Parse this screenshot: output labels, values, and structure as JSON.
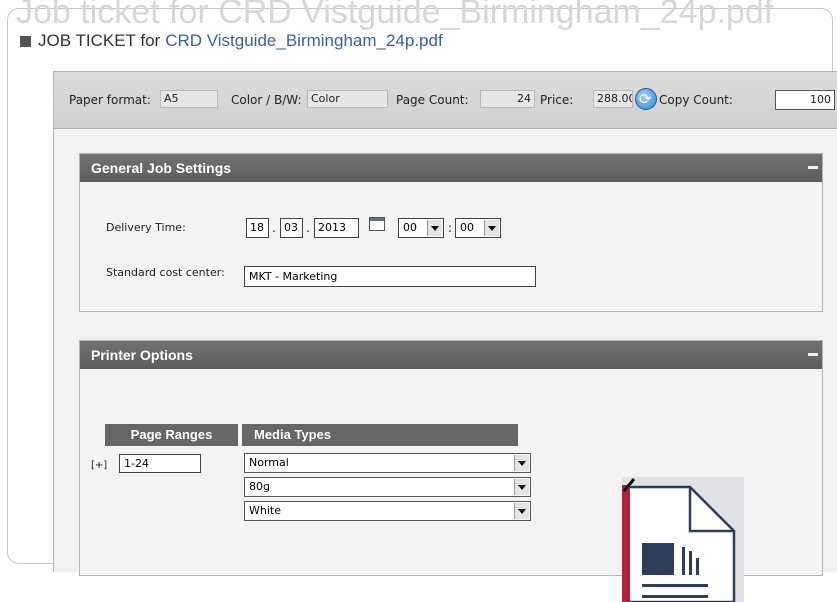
{
  "window": {
    "ghost_title": "Job ticket for CRD Vistguide_Birmingham_24p.pdf",
    "title_prefix": "JOB TICKET  for",
    "title_file": "CRD Vistguide_Birmingham_24p.pdf"
  },
  "summary": {
    "paper_format_label": "Paper format:",
    "paper_format_value": "A5",
    "color_label": "Color / B/W:",
    "color_value": "Color",
    "page_count_label": "Page Count:",
    "page_count_value": "24",
    "price_label": "Price:",
    "price_value": "288.00",
    "refresh_icon": "refresh-icon",
    "copy_count_label": "Copy Count:",
    "copy_count_value": "100"
  },
  "general": {
    "header": "General Job Settings",
    "delivery_label": "Delivery Time:",
    "day": "18",
    "month": "03",
    "year": "2013",
    "date_sep": ".",
    "calendar_icon": "calendar-icon",
    "hour": "00",
    "minute": "00",
    "time_sep": ":",
    "cost_center_label": "Standard cost center:",
    "cost_center_value": "MKT - Marketing"
  },
  "printer": {
    "header": "Printer Options",
    "col_page_ranges": "Page Ranges",
    "col_media_types": "Media Types",
    "add_range": "[+]",
    "range_value": "1-24",
    "media": [
      "Normal",
      "80g",
      "White"
    ],
    "preview_icon": "document-preview-icon"
  },
  "colors": {
    "accent_blue": "#3b5fa8",
    "header_gray": "#666666",
    "binding_red": "#b0203f",
    "doc_navy": "#2e3d5a"
  }
}
